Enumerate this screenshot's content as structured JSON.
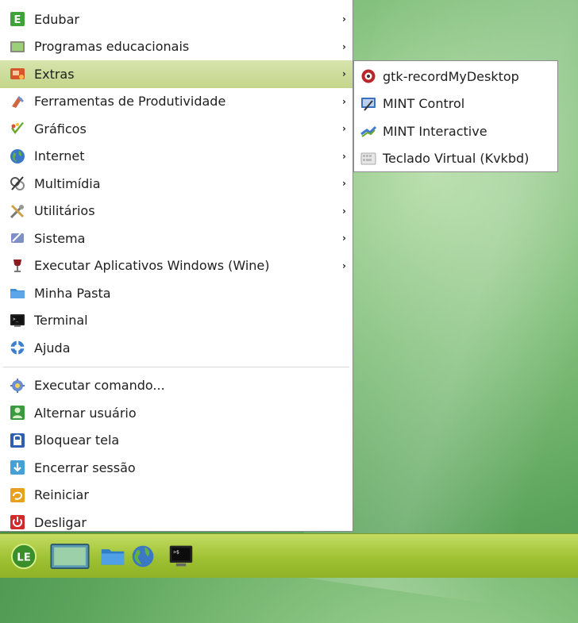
{
  "menu": {
    "items": [
      {
        "label": "Edubar",
        "icon": "edubar-icon",
        "submenu": true
      },
      {
        "label": "Programas educacionais",
        "icon": "educational-programs-icon",
        "submenu": true
      },
      {
        "label": "Extras",
        "icon": "extras-icon",
        "submenu": true,
        "active": true
      },
      {
        "label": "Ferramentas de Produtividade",
        "icon": "productivity-tools-icon",
        "submenu": true
      },
      {
        "label": "Gráficos",
        "icon": "graphics-icon",
        "submenu": true
      },
      {
        "label": "Internet",
        "icon": "internet-globe-icon",
        "submenu": true
      },
      {
        "label": "Multimídia",
        "icon": "multimedia-icon",
        "submenu": true
      },
      {
        "label": "Utilitários",
        "icon": "utilities-icon",
        "submenu": true
      },
      {
        "label": "Sistema",
        "icon": "system-icon",
        "submenu": true
      },
      {
        "label": "Executar Aplicativos Windows (Wine)",
        "icon": "wine-glass-icon",
        "submenu": true
      },
      {
        "label": "Minha Pasta",
        "icon": "home-folder-icon",
        "submenu": false
      },
      {
        "label": "Terminal",
        "icon": "terminal-icon",
        "submenu": false
      },
      {
        "label": "Ajuda",
        "icon": "help-lifebuoy-icon",
        "submenu": false
      }
    ],
    "actions": [
      {
        "label": "Executar comando...",
        "icon": "run-command-icon"
      },
      {
        "label": "Alternar usuário",
        "icon": "switch-user-icon"
      },
      {
        "label": "Bloquear tela",
        "icon": "lock-screen-icon"
      },
      {
        "label": "Encerrar sessão",
        "icon": "logout-icon"
      },
      {
        "label": "Reiniciar",
        "icon": "restart-icon"
      },
      {
        "label": "Desligar",
        "icon": "shutdown-icon"
      }
    ],
    "arrow_glyph": "›"
  },
  "submenu_extras": {
    "items": [
      {
        "label": "gtk-recordMyDesktop",
        "icon": "record-desktop-icon"
      },
      {
        "label": "MINT Control",
        "icon": "mint-control-icon"
      },
      {
        "label": "MINT Interactive",
        "icon": "mint-interactive-icon"
      },
      {
        "label": "Teclado Virtual (Kvkbd)",
        "icon": "virtual-keyboard-icon"
      }
    ]
  },
  "taskbar": {
    "items": [
      {
        "icon": "linux-educacional-start-icon"
      },
      {
        "icon": "show-desktop-icon"
      },
      {
        "icon": "file-manager-folder-icon"
      },
      {
        "icon": "web-browser-globe-icon"
      },
      {
        "icon": "terminal-icon"
      }
    ]
  },
  "colors": {
    "highlight": "#c8d896",
    "taskbar": "#a6c53a",
    "desktop": "#6aaa64"
  }
}
